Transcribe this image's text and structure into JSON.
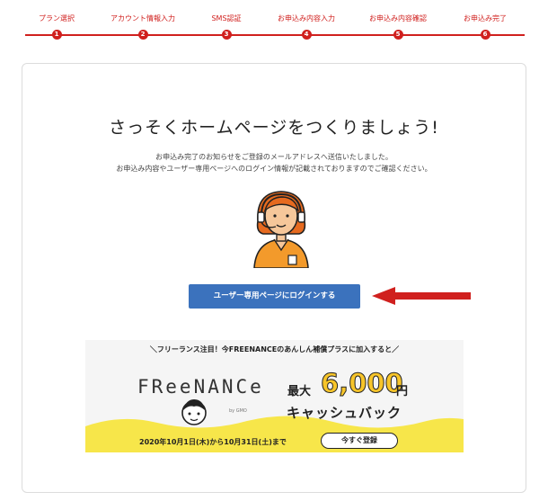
{
  "steps": [
    {
      "label": "プラン選択",
      "num": "1"
    },
    {
      "label": "アカウント情報入力",
      "num": "2"
    },
    {
      "label": "SMS認証",
      "num": "3"
    },
    {
      "label": "お申込み内容入力",
      "num": "4"
    },
    {
      "label": "お申込み内容確認",
      "num": "5"
    },
    {
      "label": "お申込み完了",
      "num": "6"
    }
  ],
  "main": {
    "title": "さっそくホームページをつくりましょう!",
    "desc_line1": "お申込み完了のお知らせをご登録のメールアドレスへ送信いたしました。",
    "desc_line2": "お申込み内容やユーザー専用ページへのログイン情報が記載されておりますのでご確認ください。",
    "cta_label": "ユーザー専用ページにログインする"
  },
  "banner": {
    "headline": "＼フリーランス注目！今FREENANCEのあんしん補償プラスに加入すると／",
    "logo": "FReeNANCe",
    "sublogo": "by GMO",
    "reward_prefix": "最大",
    "reward_amount": "6,000",
    "reward_suffix": "円",
    "reward_cashback": "キャッシュバック",
    "campaign_date": "2020年10月1日(木)から10月31日(土)まで",
    "register_label": "今すぐ登録"
  },
  "colors": {
    "accent": "#d0201e",
    "button": "#3b72bd",
    "banner_yellow": "#f7e64a",
    "amount": "#f7c52a"
  }
}
